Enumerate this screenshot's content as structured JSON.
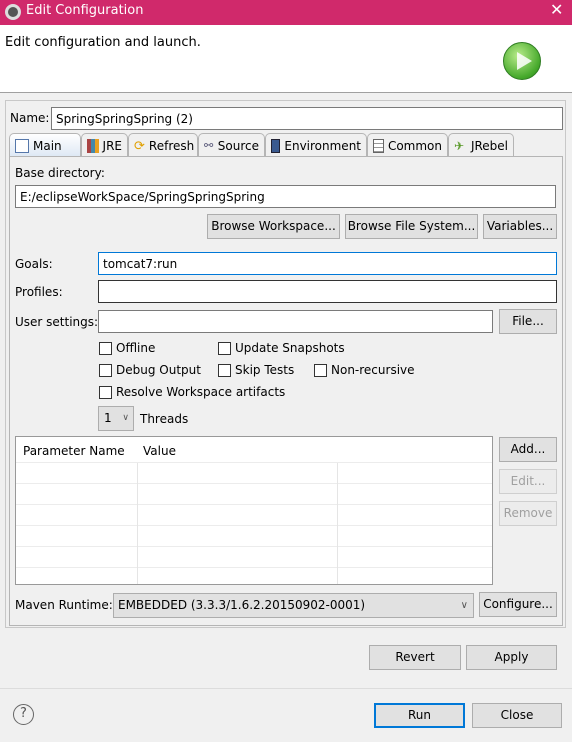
{
  "window": {
    "title": "Edit Configuration",
    "close_icon": "close-icon"
  },
  "header": {
    "message": "Edit configuration and launch.",
    "icon": "run-launch-icon",
    "accent": "#d0296b"
  },
  "name": {
    "label": "Name:",
    "value": "SpringSpringSpring (2)"
  },
  "tabs": [
    {
      "label": "Main",
      "icon": "main-tab-icon"
    },
    {
      "label": "JRE",
      "icon": "jre-icon"
    },
    {
      "label": "Refresh",
      "icon": "refresh-icon"
    },
    {
      "label": "Source",
      "icon": "source-icon"
    },
    {
      "label": "Environment",
      "icon": "environment-icon"
    },
    {
      "label": "Common",
      "icon": "common-icon"
    },
    {
      "label": "JRebel",
      "icon": "jrebel-icon"
    }
  ],
  "main": {
    "base_dir_label": "Base directory:",
    "base_dir_value": "E:/eclipseWorkSpace/SpringSpringSpring",
    "browse_workspace": "Browse Workspace...",
    "browse_fs": "Browse File System...",
    "variables": "Variables...",
    "goals_label": "Goals:",
    "goals_value": "tomcat7:run",
    "profiles_label": "Profiles:",
    "profiles_value": "",
    "user_settings_label": "User settings:",
    "user_settings_value": "",
    "file_button": "File...",
    "checkboxes": [
      {
        "label": "Offline",
        "checked": false
      },
      {
        "label": "Update Snapshots",
        "checked": false
      },
      {
        "label": "Debug Output",
        "checked": false
      },
      {
        "label": "Skip Tests",
        "checked": false
      },
      {
        "label": "Non-recursive",
        "checked": false
      },
      {
        "label": "Resolve Workspace artifacts",
        "checked": false
      }
    ],
    "threads_value": "1",
    "threads_label": "Threads",
    "table": {
      "columns": [
        "Parameter Name",
        "Value"
      ],
      "rows": []
    },
    "add": "Add...",
    "edit": "Edit...",
    "remove": "Remove",
    "runtime_label": "Maven Runtime:",
    "runtime_value": "EMBEDDED (3.3.3/1.6.2.20150902-0001)",
    "configure": "Configure..."
  },
  "footer": {
    "revert": "Revert",
    "apply": "Apply",
    "run": "Run",
    "close": "Close",
    "help_icon": "help-icon"
  }
}
